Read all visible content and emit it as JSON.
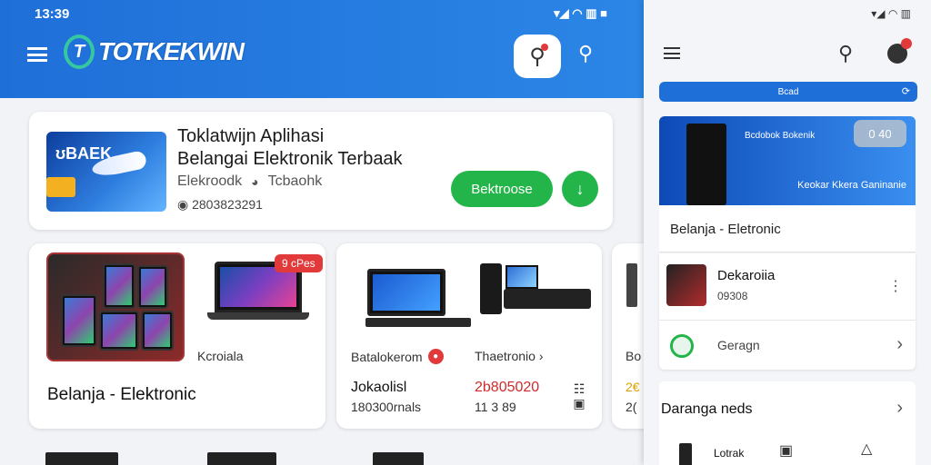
{
  "status_bar": {
    "time": "13:39",
    "icons": "▾◢ ◠ ▥ ■"
  },
  "header": {
    "logo_mark": "T",
    "logo_text": "TOTKEKWIN"
  },
  "app_card": {
    "title_line1": "Toklatwijn Aplihasi",
    "title_line2": "Belangai Elektronik Terbaak",
    "category": "Elekroodk",
    "developer": "Tcbaohk",
    "downloads": "2803823291",
    "install_label": "Bektroose",
    "download_icon": "↓"
  },
  "product_cards": [
    {
      "price_tag": "9 cPes",
      "small_label": "Kcroiala",
      "title": "Belanja - Elektronic"
    },
    {
      "label_a": "Batalokerom",
      "label_b": "Thaetronio ›",
      "name": "Jokaolisl",
      "sub": "180300rnals",
      "price": "2b805020",
      "price_sub": "11 3 89"
    },
    {
      "label_a": "Bo",
      "label_b": "2€",
      "label_c": "2("
    }
  ],
  "panel": {
    "status_icons": "▾◢ ◠ ▥",
    "search_bar_label": "Bcad",
    "hero": {
      "caption": "Bcdobok Bokenik",
      "pill": "0 40",
      "tag": "Keokar Kkera Ganinanie"
    },
    "hero_title": "Belanja - Eletronic",
    "item1": {
      "title": "Dekaroiia",
      "sub": "09308"
    },
    "item2": {
      "title": "Geragn"
    },
    "section": {
      "title": "Daranga neds",
      "sub": "Lotrak"
    }
  },
  "colors": {
    "primary": "#1f6fd8",
    "accent_green": "#23b54a",
    "alert_red": "#e23a3a"
  }
}
